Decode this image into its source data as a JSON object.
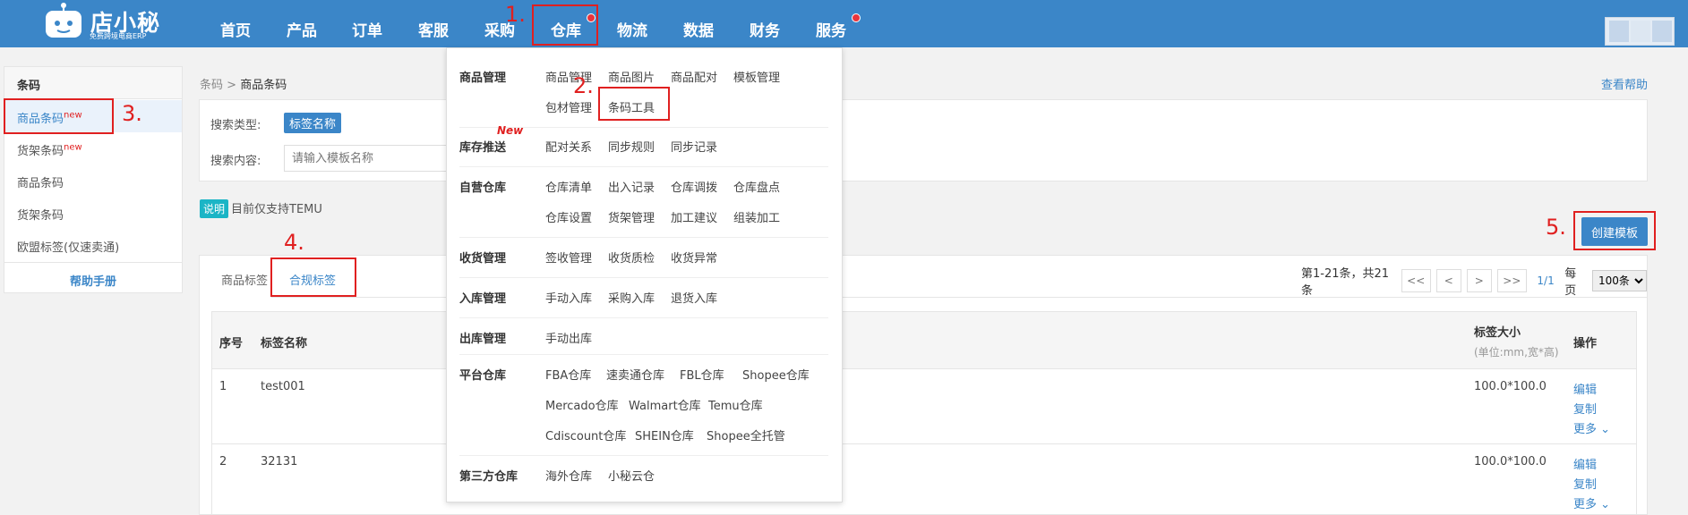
{
  "app": {
    "logo_text": "店小秘",
    "logo_sub": "免费跨境电商ERP"
  },
  "nav": {
    "items": [
      "首页",
      "产品",
      "订单",
      "客服",
      "采购",
      "仓库",
      "物流",
      "数据",
      "财务",
      "服务"
    ]
  },
  "annotations": [
    "1.",
    "2.",
    "3.",
    "4.",
    "5."
  ],
  "sidebar": {
    "title": "条码",
    "items": [
      {
        "label": "商品条码",
        "badge": "new"
      },
      {
        "label": "货架条码",
        "badge": "new"
      },
      {
        "label": "商品条码",
        "badge": ""
      },
      {
        "label": "货架条码",
        "badge": ""
      },
      {
        "label": "欧盟标签(仅速卖通)",
        "badge": ""
      }
    ],
    "help": "帮助手册"
  },
  "breadcrumb": {
    "parent": "条码",
    "sep": ">",
    "current": "商品条码"
  },
  "help_link": "查看帮助",
  "search": {
    "type_label": "搜索类型:",
    "type_value": "标签名称",
    "content_label": "搜索内容:",
    "placeholder": "请输入模板名称"
  },
  "note": {
    "badge": "说明",
    "text": "目前仅支持TEMU"
  },
  "create_button": "创建模板",
  "tabs": [
    "商品标签",
    "合规标签"
  ],
  "pager": {
    "summary": "第1-21条，共21条",
    "first": "<<",
    "prev": "<",
    "next": ">",
    "last": ">>",
    "current": "1/1",
    "per_page_label": "每页",
    "per_page_value": "100条"
  },
  "table": {
    "headers": {
      "index": "序号",
      "name": "标签名称",
      "size": "标签大小",
      "size_unit": "(单位:mm,宽*高)",
      "ops": "操作"
    },
    "rows": [
      {
        "index": "1",
        "name": "test001",
        "size": "100.0*100.0"
      },
      {
        "index": "2",
        "name": "32131",
        "size": "100.0*100.0"
      }
    ],
    "actions": {
      "edit": "编辑",
      "copy": "复制",
      "more": "更多"
    }
  },
  "dropdown": {
    "new_badge": "New",
    "groups": [
      {
        "title": "商品管理",
        "links": [
          [
            "商品管理",
            "商品图片",
            "商品配对",
            "模板管理"
          ],
          [
            "包材管理",
            "条码工具"
          ]
        ]
      },
      {
        "title": "库存推送",
        "links": [
          [
            "配对关系",
            "同步规则",
            "同步记录"
          ]
        ]
      },
      {
        "title": "自营仓库",
        "links": [
          [
            "仓库清单",
            "出入记录",
            "仓库调拨",
            "仓库盘点"
          ],
          [
            "仓库设置",
            "货架管理",
            "加工建议",
            "组装加工"
          ]
        ]
      },
      {
        "title": "收货管理",
        "links": [
          [
            "签收管理",
            "收货质检",
            "收货异常"
          ]
        ]
      },
      {
        "title": "入库管理",
        "links": [
          [
            "手动入库",
            "采购入库",
            "退货入库"
          ]
        ]
      },
      {
        "title": "出库管理",
        "links": [
          [
            "手动出库"
          ]
        ]
      },
      {
        "title": "平台仓库",
        "links": [
          [
            "FBA仓库",
            "速卖通仓库",
            "FBL仓库",
            "Shopee仓库"
          ],
          [
            "Mercado仓库",
            "Walmart仓库",
            "Temu仓库"
          ],
          [
            "Cdiscount仓库",
            "SHEIN仓库",
            "Shopee全托管"
          ]
        ]
      },
      {
        "title": "第三方仓库",
        "links": [
          [
            "海外仓库",
            "小秘云仓"
          ]
        ]
      }
    ]
  }
}
